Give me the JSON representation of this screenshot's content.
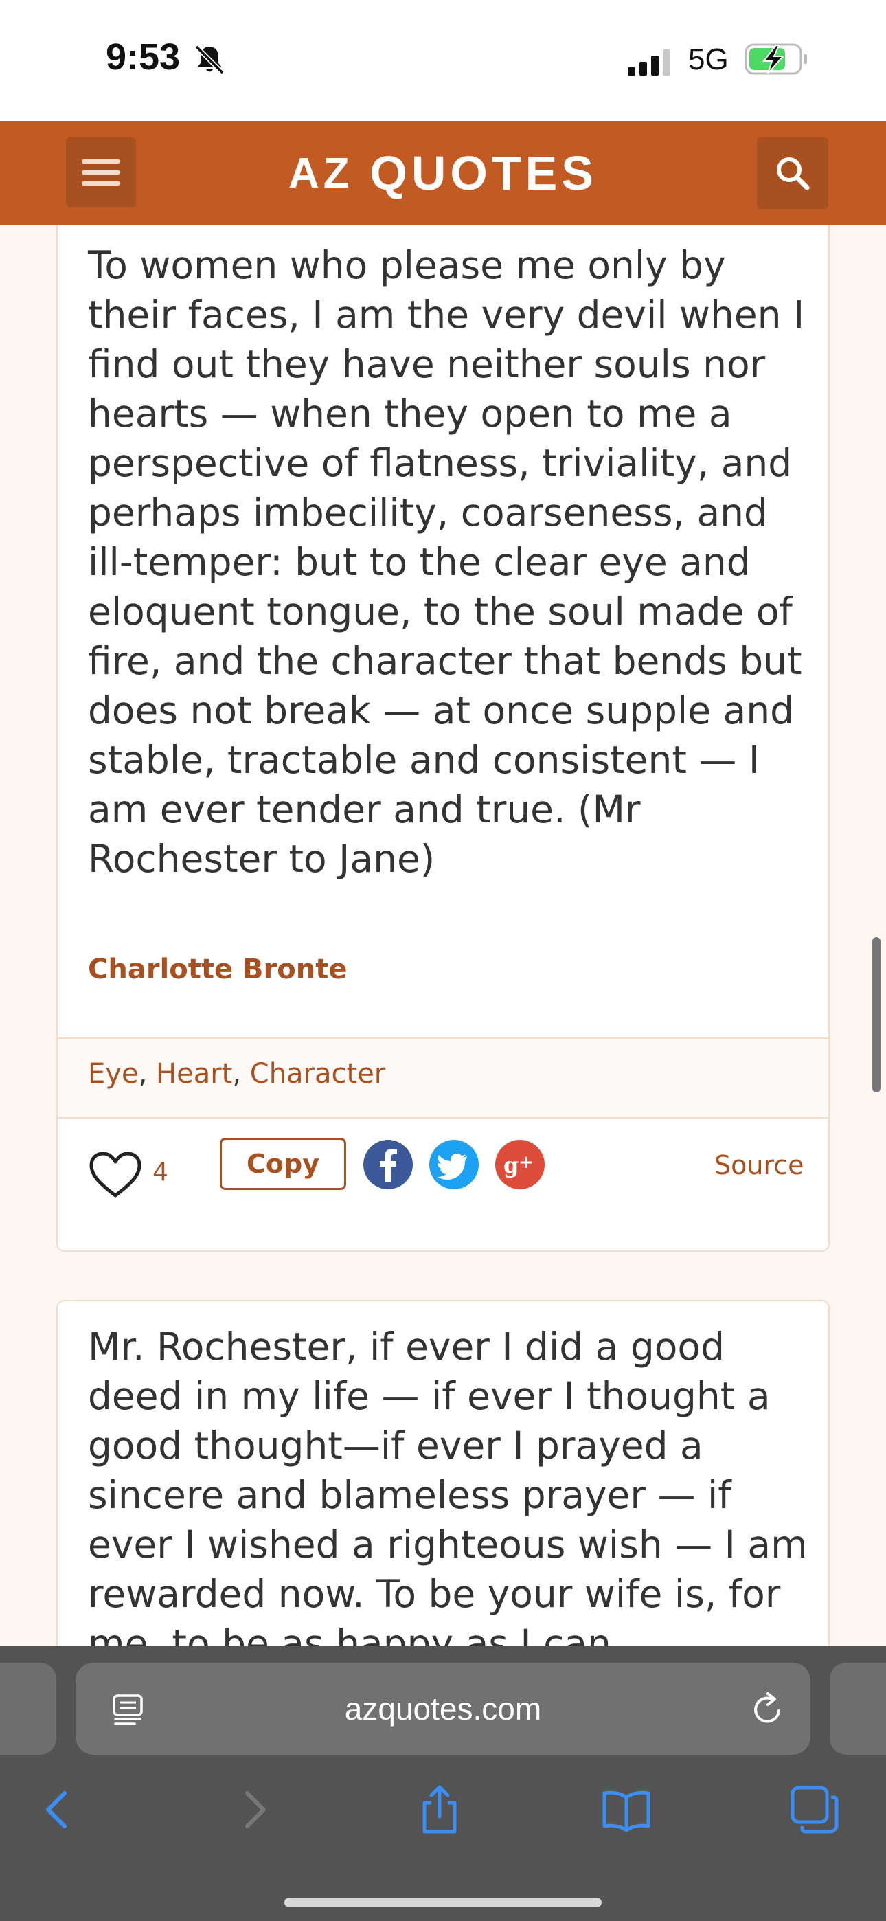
{
  "status_bar": {
    "time": "9:53",
    "network": "5G"
  },
  "header": {
    "logo": {
      "part1": "AZ",
      "part2": "QUOTES"
    }
  },
  "quotes": [
    {
      "text": "To women who please me only by their faces, I am the very devil when I find out they have neither souls nor hearts — when they open to me a perspective of flatness, triviality, and perhaps imbecility, coarseness, and ill-temper: but to the clear eye and eloquent tongue, to the soul made of fire, and the character that bends but does not break — at once supple and stable, tractable and consistent — I am ever tender and true. (Mr Rochester to Jane)",
      "author": "Charlotte Bronte",
      "tags": [
        "Eye",
        "Heart",
        "Character"
      ],
      "likes": "4",
      "copy_label": "Copy",
      "source_label": "Source"
    },
    {
      "text": "Mr. Rochester, if ever I did a good deed in my life — if ever I thought a good thought—if ever I prayed a sincere and blameless prayer — if ever I wished a righteous wish — I am rewarded now. To be your wife is, for me, to be as happy as I can"
    }
  ],
  "browser": {
    "url": "azquotes.com"
  },
  "colors": {
    "brand": "#c25a23",
    "link": "#a8501f",
    "background": "#fdf7f1"
  }
}
